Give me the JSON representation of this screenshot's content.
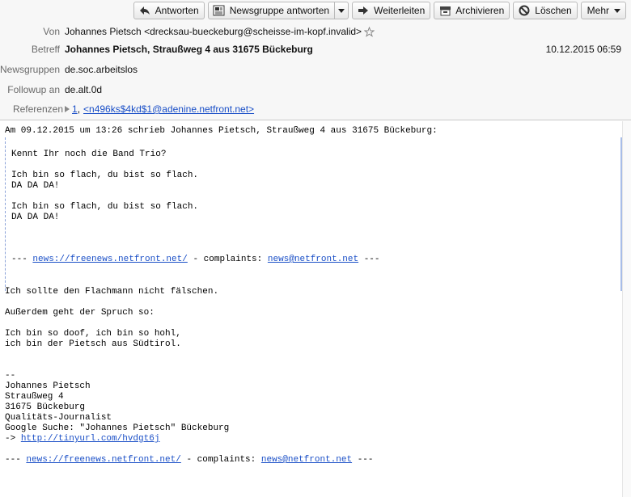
{
  "toolbar": {
    "reply": "Antworten",
    "reply_group": "Newsgruppe antworten",
    "forward": "Weiterleiten",
    "archive": "Archivieren",
    "delete": "Löschen",
    "more": "Mehr"
  },
  "headers": {
    "from_label": "Von",
    "from_value": "Johannes Pietsch <drecksau-bueckeburg@scheisse-im-kopf.invalid>",
    "subject_label": "Betreff",
    "subject_value": "Johannes Pietsch, Straußweg 4 aus 31675 Bückeburg",
    "date": "10.12.2015 06:59",
    "newsgroups_label": "Newsgruppen",
    "newsgroups_value": "de.soc.arbeitslos",
    "followup_label": "Followup an",
    "followup_value": "de.alt.0d",
    "references_label": "Referenzen",
    "ref_1": "1",
    "ref_sep": ",",
    "ref_2": "<n496ks$4kd$1@adenine.netfront.net>"
  },
  "message": {
    "attribution": "Am 09.12.2015 um 13:26 schrieb Johannes Pietsch, Straußweg 4 aus 31675 Bückeburg:",
    "quote_line1": "Kennt Ihr noch die Band Trio?",
    "quote_line2": "Ich bin so flach, du bist so flach.",
    "quote_line3": "DA DA DA!",
    "quote_line4": "Ich bin so flach, du bist so flach.",
    "quote_line5": "DA DA DA!",
    "quote_footer_prefix": "--- ",
    "quote_footer_link1": "news://freenews.netfront.net/",
    "quote_footer_mid": " - complaints: ",
    "quote_footer_link2": "news@netfront.net",
    "quote_footer_suffix": " ---",
    "line1": "Ich sollte den Flachmann nicht fälschen.",
    "line2": "Außerdem geht der Spruch so:",
    "line3": "Ich bin so doof, ich bin so hohl,",
    "line4": "ich bin der Pietsch aus Südtirol.",
    "sig_dash": "--",
    "sig1": "Johannes Pietsch",
    "sig2": "Straußweg 4",
    "sig3": "31675 Bückeburg",
    "sig4": "Qualitäts-Journalist",
    "sig5": "Google Suche: \"Johannes Pietsch\" Bückeburg",
    "sig6_prefix": "-> ",
    "sig6_link": "http://tinyurl.com/hvdgt6j",
    "footer_prefix": "--- ",
    "footer_link1": "news://freenews.netfront.net/",
    "footer_mid": " - complaints: ",
    "footer_link2": "news@netfront.net",
    "footer_suffix": " ---"
  }
}
